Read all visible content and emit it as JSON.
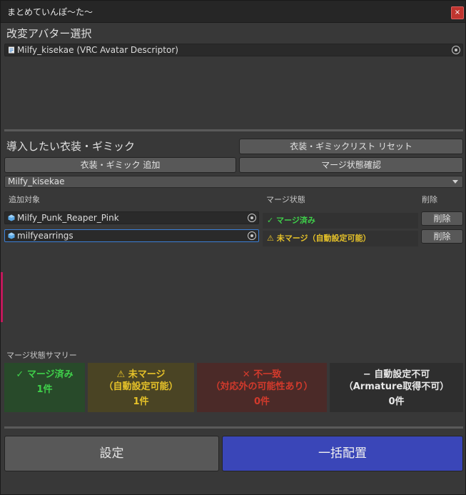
{
  "window": {
    "title": "まとめていんぽ〜た〜",
    "close_label": "×"
  },
  "avatar": {
    "section_label": "改変アバター選択",
    "field_value": "Milfy_kisekae (VRC Avatar Descriptor)"
  },
  "gimmick": {
    "section_label": "導入したい衣装・ギミック",
    "reset_button": "衣装・ギミックリスト リセット",
    "add_button": "衣装・ギミック 追加",
    "check_button": "マージ状態確認",
    "dropdown_value": "Milfy_kisekae"
  },
  "table": {
    "headers": {
      "target": "追加対象",
      "status": "マージ状態",
      "delete": "削除"
    },
    "rows": [
      {
        "name": "Milfy_Punk_Reaper_Pink",
        "status": "✓ マージ済み",
        "status_color": "#3fd04a",
        "delete_label": "削除"
      },
      {
        "name": "milfyearrings",
        "status": "⚠ 未マージ（自動設定可能）",
        "status_color": "#e6c229",
        "delete_label": "削除"
      }
    ]
  },
  "summary": {
    "title": "マージ状態サマリー",
    "boxes": [
      {
        "line1": "✓ マージ済み",
        "line2": "",
        "count": "1件",
        "color": "#3fd04a",
        "bg": "#284a2a"
      },
      {
        "line1": "⚠ 未マージ",
        "line2": "（自動設定可能）",
        "count": "1件",
        "color": "#e6c229",
        "bg": "#4a4424"
      },
      {
        "line1": "✕ 不一致",
        "line2": "（対応外の可能性あり）",
        "count": "0件",
        "color": "#d23a2c",
        "bg": "#4b2a28"
      },
      {
        "line1": "− 自動設定不可",
        "line2": "（Armature取得不可）",
        "count": "0件",
        "color": "#e8e8e8",
        "bg": "#2e2e2e"
      }
    ]
  },
  "actions": {
    "settings_label": "設定",
    "place_all_label": "一括配置",
    "place_all_color": "#3a46b8"
  }
}
